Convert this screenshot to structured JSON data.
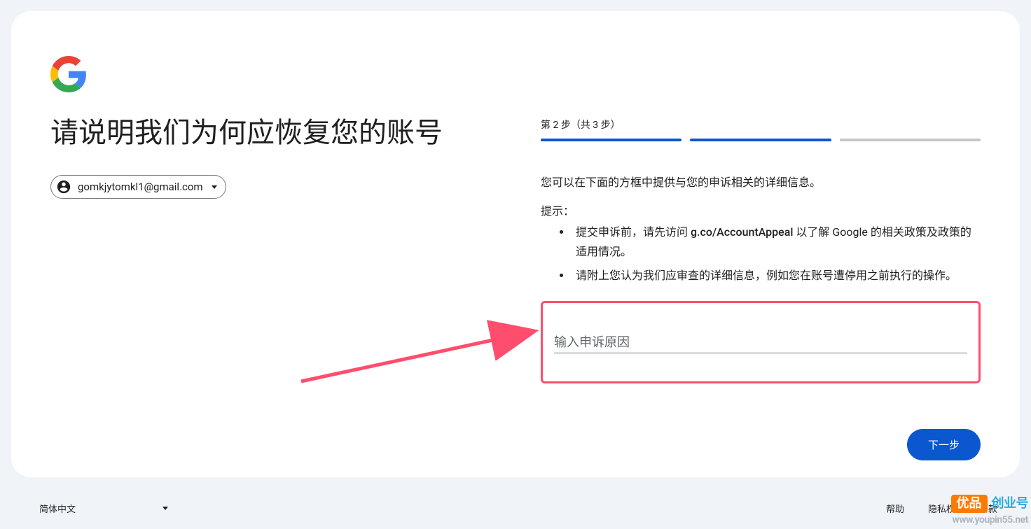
{
  "header": {
    "title": "请说明我们为何应恢复您的账号"
  },
  "account": {
    "email": "gomkjytomkl1@gmail.com"
  },
  "progress": {
    "label": "第 2 步（共 3 步）",
    "current": 2,
    "total": 3
  },
  "instructions": {
    "intro": "您可以在下面的方框中提供与您的申诉相关的详细信息。",
    "tips_label": "提示：",
    "tip1_prefix": "提交申诉前，请先访问 ",
    "tip1_link": "g.co/AccountAppeal",
    "tip1_suffix": " 以了解 Google 的相关政策及政策的适用情况。",
    "tip2": "请附上您认为我们应审查的详细信息，例如您在账号遭停用之前执行的操作。"
  },
  "input": {
    "placeholder": "输入申诉原因",
    "value": ""
  },
  "actions": {
    "next": "下一步"
  },
  "footer": {
    "language": "简体中文",
    "help": "帮助",
    "privacy": "隐私权",
    "terms": "条款"
  },
  "watermark": {
    "badge": "优品",
    "text1": "创业号",
    "text2": "www.youpin55.net"
  }
}
